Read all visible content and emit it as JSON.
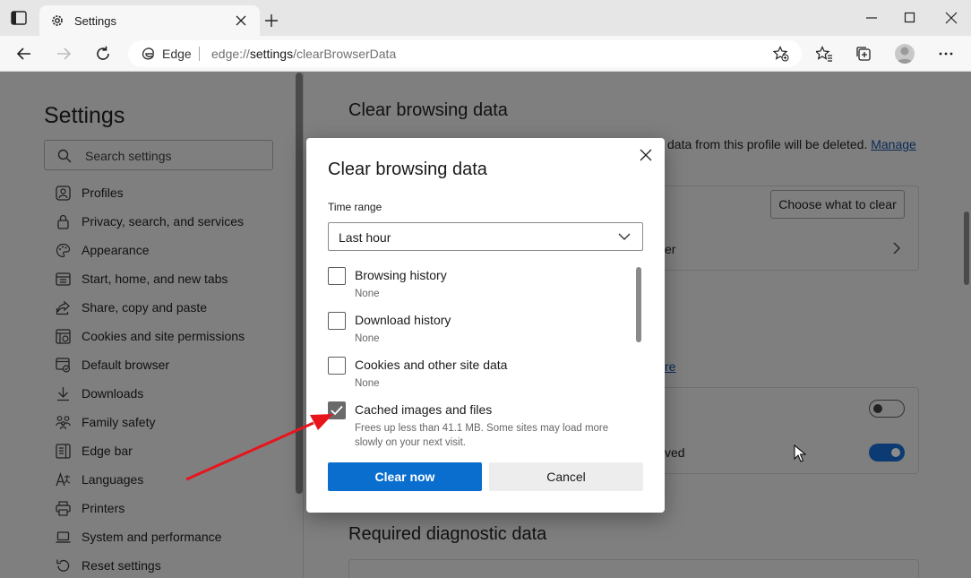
{
  "browser": {
    "tab_title": "Settings",
    "address_brand": "Edge",
    "address_scheme": "edge://",
    "address_host": "settings",
    "address_path": "/clearBrowserData"
  },
  "sidebar": {
    "title": "Settings",
    "search_placeholder": "Search settings",
    "items": [
      {
        "label": "Profiles",
        "icon": "profile-icon"
      },
      {
        "label": "Privacy, search, and services",
        "icon": "lock-icon"
      },
      {
        "label": "Appearance",
        "icon": "palette-icon"
      },
      {
        "label": "Start, home, and new tabs",
        "icon": "home-tabs-icon"
      },
      {
        "label": "Share, copy and paste",
        "icon": "share-icon"
      },
      {
        "label": "Cookies and site permissions",
        "icon": "cookie-permissions-icon"
      },
      {
        "label": "Default browser",
        "icon": "default-browser-icon"
      },
      {
        "label": "Downloads",
        "icon": "download-icon"
      },
      {
        "label": "Family safety",
        "icon": "family-icon"
      },
      {
        "label": "Edge bar",
        "icon": "edge-bar-icon"
      },
      {
        "label": "Languages",
        "icon": "languages-icon"
      },
      {
        "label": "Printers",
        "icon": "printer-icon"
      },
      {
        "label": "System and performance",
        "icon": "laptop-icon"
      },
      {
        "label": "Reset settings",
        "icon": "reset-icon"
      }
    ]
  },
  "main": {
    "section_title": "Clear browsing data",
    "desc_tail": "data from this profile will be deleted.",
    "manage_link": "Manage",
    "choose_button": "Choose what to clear",
    "row2_tail": "er",
    "link2_tail": "re",
    "row_toggle2_tail": "ved",
    "toggle1_on": false,
    "toggle2_on": true,
    "section2_title": "Required diagnostic data"
  },
  "dialog": {
    "title": "Clear browsing data",
    "time_range_label": "Time range",
    "time_range_value": "Last hour",
    "options": [
      {
        "label": "Browsing history",
        "sub": "None",
        "checked": false
      },
      {
        "label": "Download history",
        "sub": "None",
        "checked": false
      },
      {
        "label": "Cookies and other site data",
        "sub": "None",
        "checked": false
      },
      {
        "label": "Cached images and files",
        "sub": "Frees up less than 41.1 MB. Some sites may load more slowly on your next visit.",
        "checked": true
      }
    ],
    "primary_button": "Clear now",
    "secondary_button": "Cancel"
  },
  "colors": {
    "accent": "#0a6ecf",
    "annotation_arrow": "#e8141c",
    "overlay": "#7f7f7f"
  }
}
